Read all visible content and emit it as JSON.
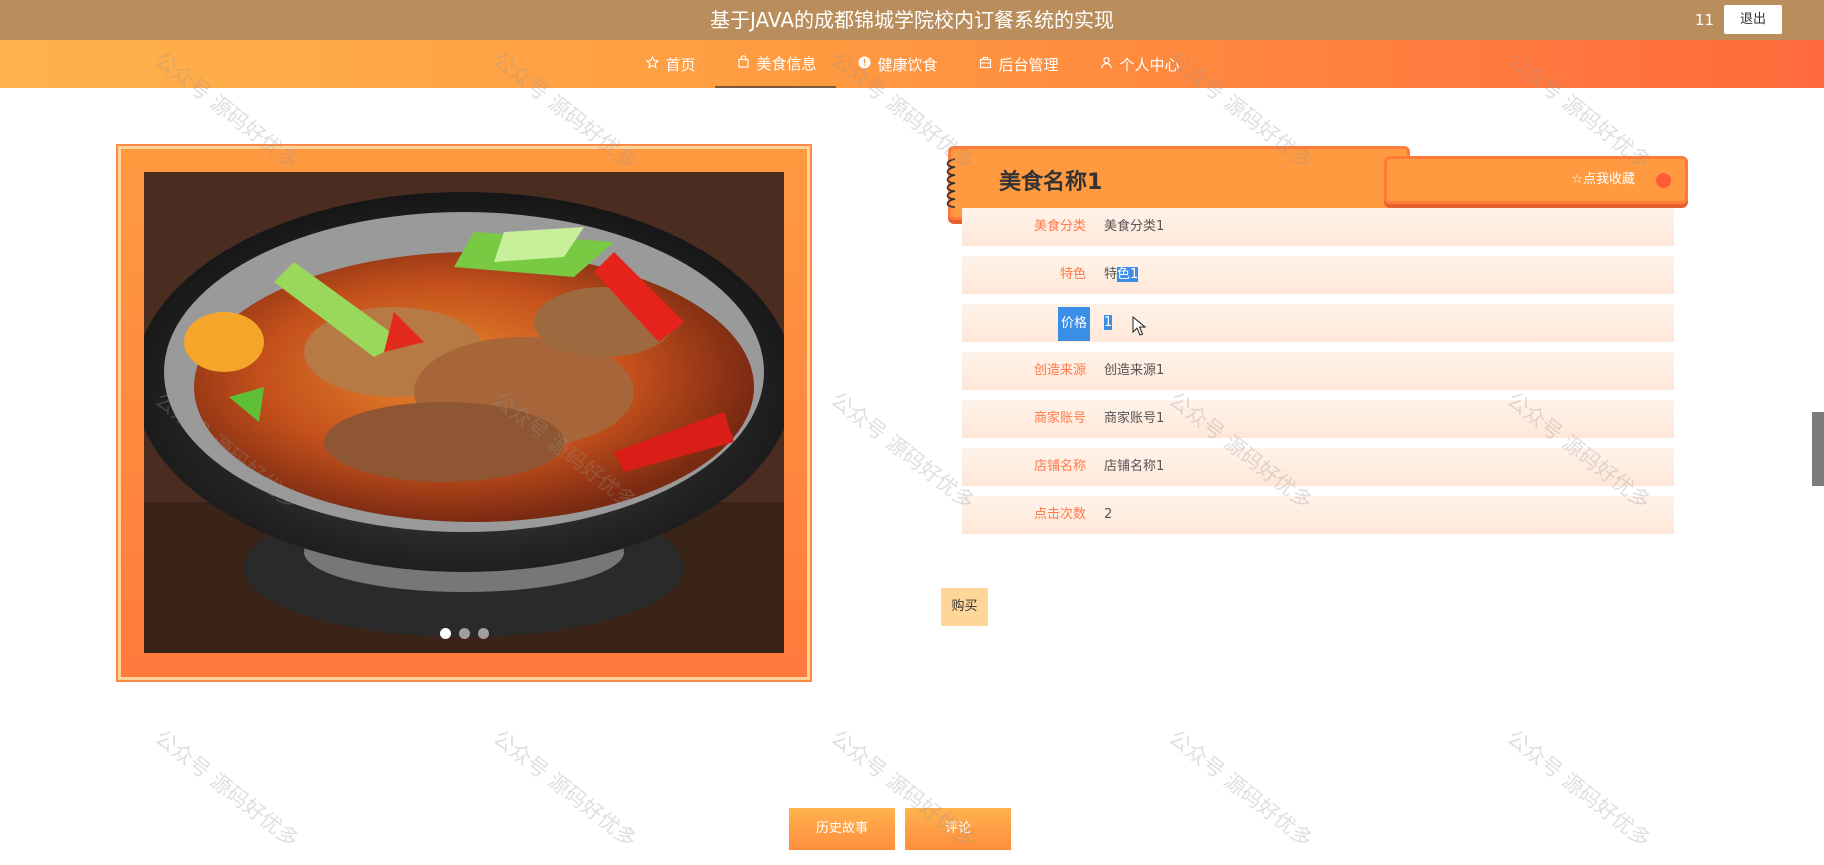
{
  "header": {
    "site_title": "基于JAVA的成都锦城学院校内订餐系统的实现",
    "user_name": "11",
    "logout_label": "退出"
  },
  "nav": {
    "items": [
      {
        "label": "首页",
        "icon": "home-icon"
      },
      {
        "label": "美食信息",
        "icon": "bag-icon",
        "active": true
      },
      {
        "label": "健康饮食",
        "icon": "info-circle-icon"
      },
      {
        "label": "后台管理",
        "icon": "briefcase-icon"
      },
      {
        "label": "个人中心",
        "icon": "user-icon"
      }
    ]
  },
  "gallery": {
    "image": "stir-fried-fish-in-wok",
    "slide_count": 3,
    "active_slide": 1
  },
  "detail": {
    "food_name": "美食名称1",
    "favorite_label": "☆点我收藏",
    "fields": [
      {
        "label": "美食分类",
        "value": "美食分类1"
      },
      {
        "label": "特色",
        "value_plain": "特",
        "value_selected": "色1"
      },
      {
        "label": "价格",
        "value": "1"
      },
      {
        "label": "创造来源",
        "value": "创造来源1"
      },
      {
        "label": "商家账号",
        "value": "商家账号1"
      },
      {
        "label": "店铺名称",
        "value": "店铺名称1"
      },
      {
        "label": "点击次数",
        "value": "2"
      }
    ],
    "buy_label": "购买"
  },
  "tabs": {
    "history_label": "历史故事",
    "comment_label": "评论"
  },
  "watermark": "公众号 源码好优多",
  "colors": {
    "topbar": "#b98d5c",
    "accent": "#ff9a40",
    "accent_dark": "#ff6a3d",
    "label": "#ff7a4a",
    "selection": "#3a8ee6"
  }
}
